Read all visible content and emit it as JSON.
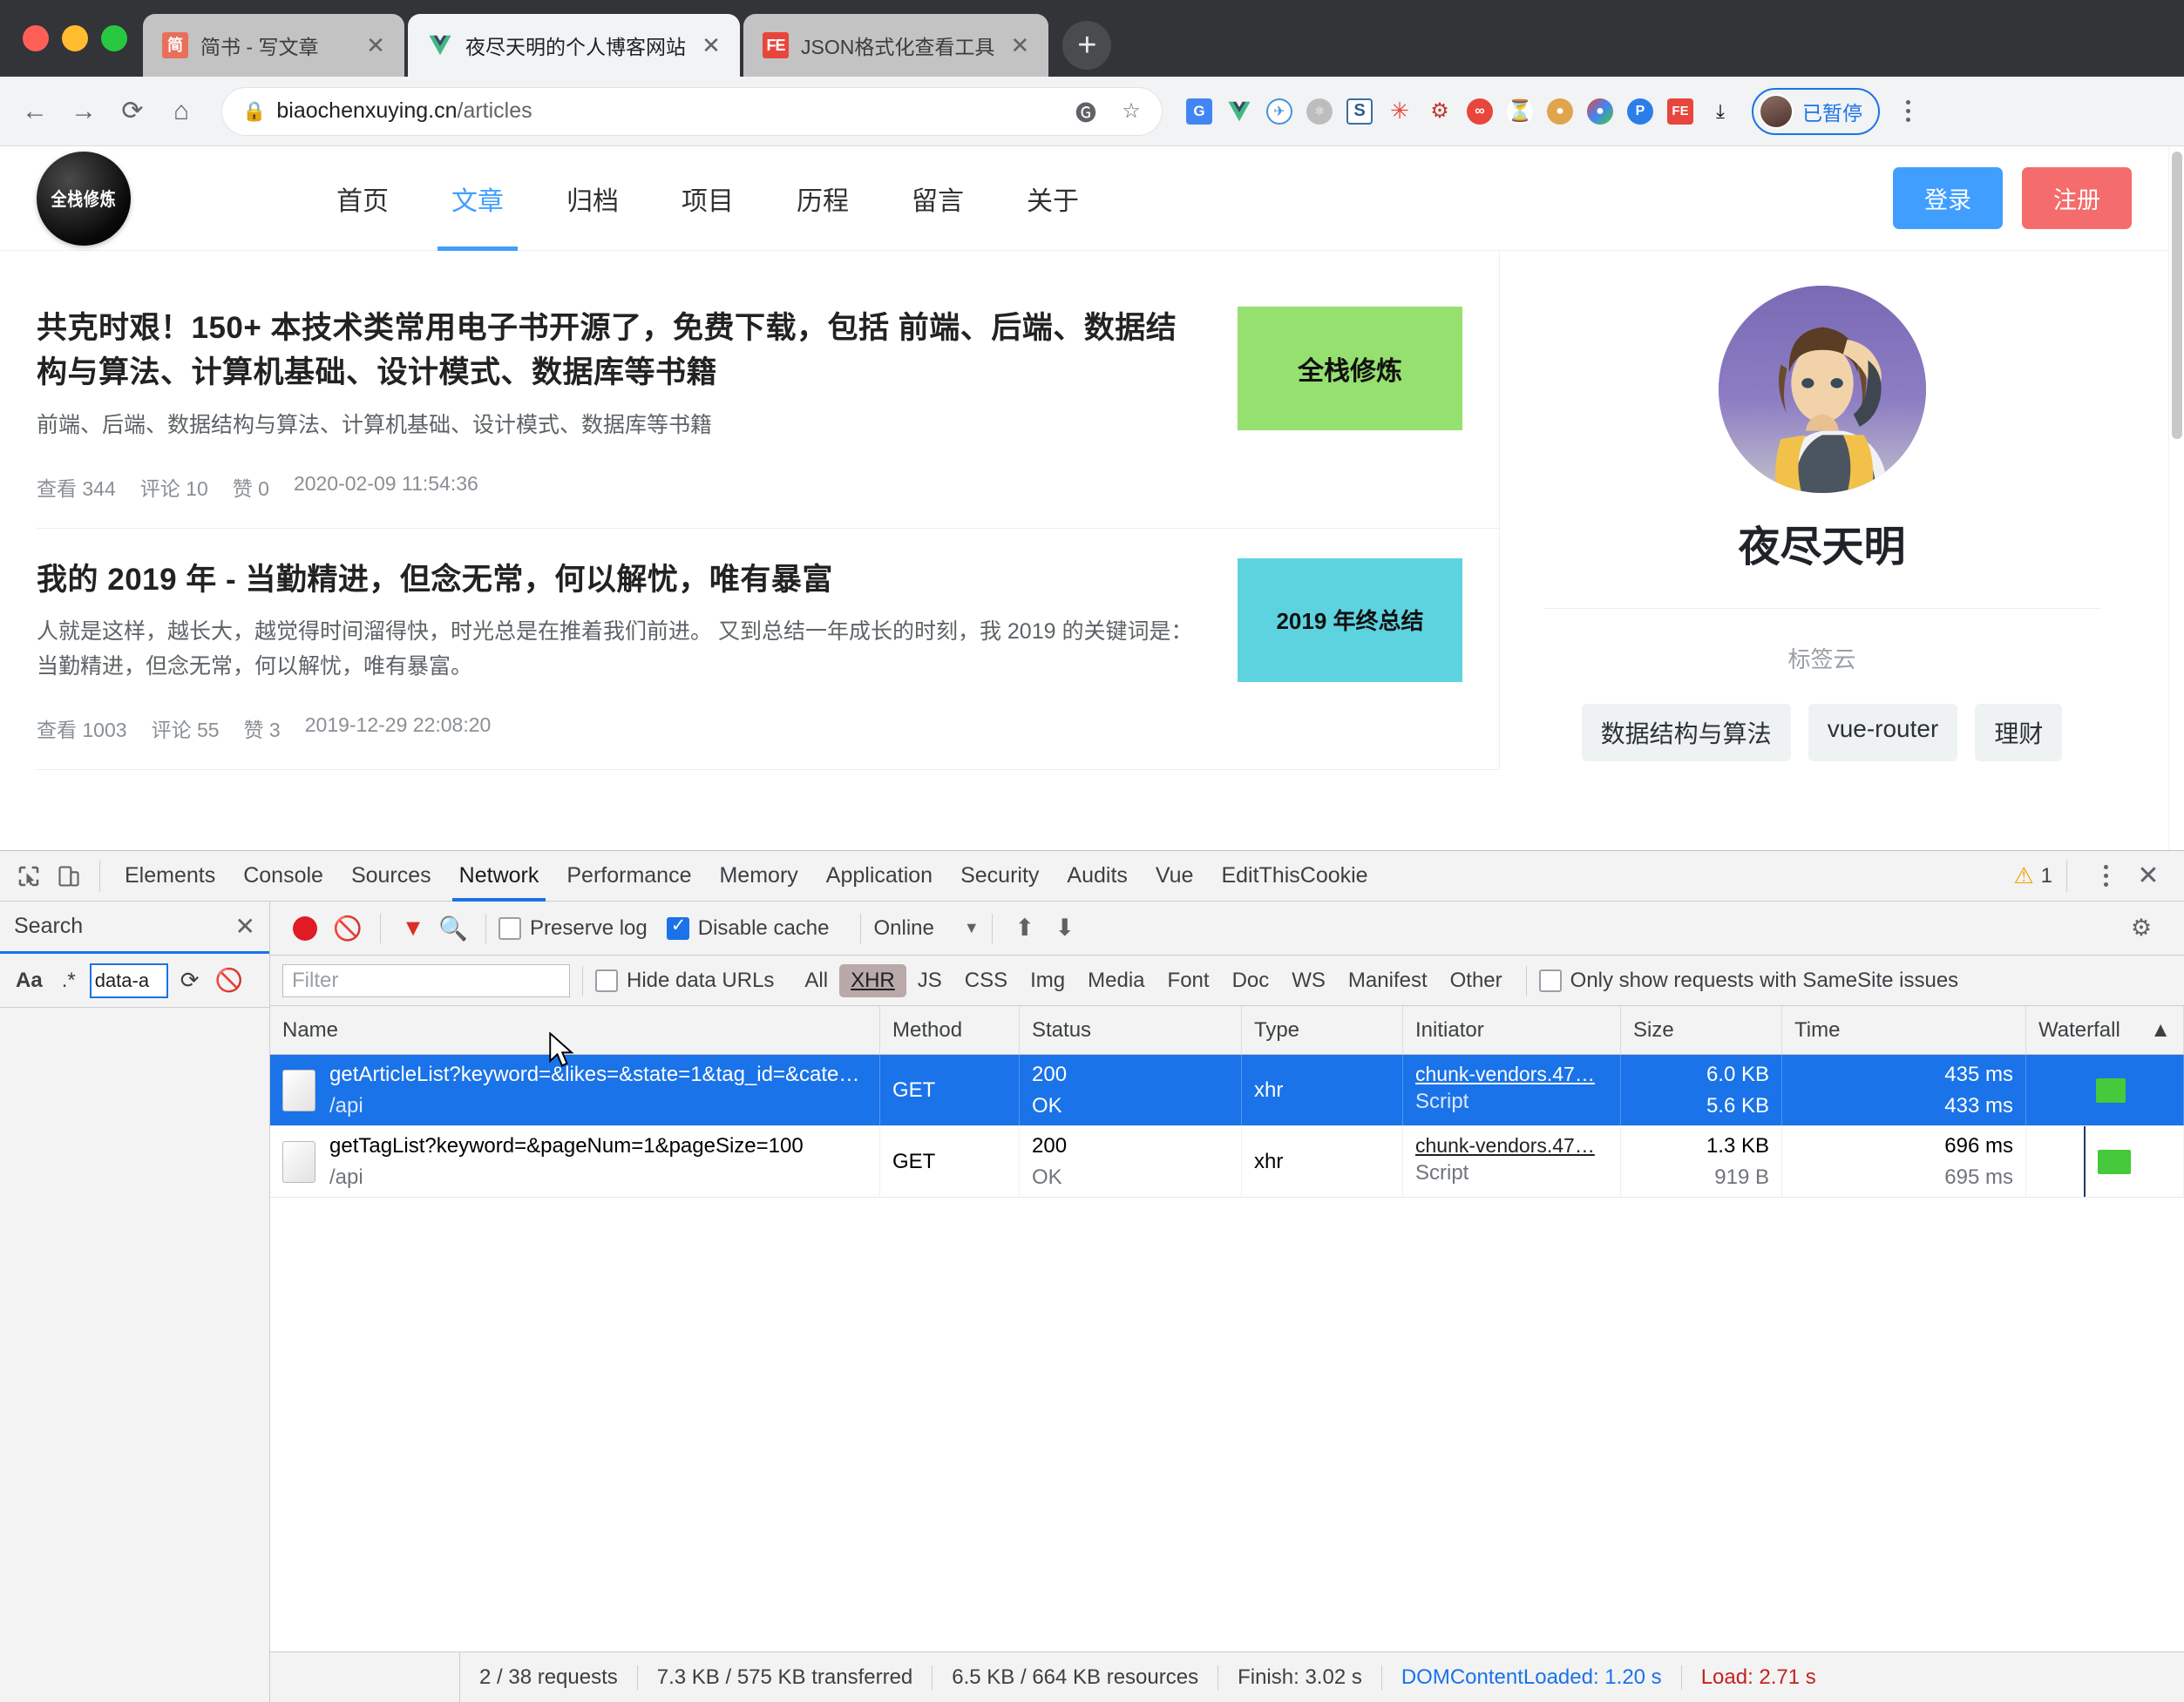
{
  "browser": {
    "tabs": [
      {
        "title": "简书 - 写文章",
        "favicon": "jianshu-icon",
        "active": false
      },
      {
        "title": "夜尽天明的个人博客网站",
        "favicon": "vue-icon",
        "active": true
      },
      {
        "title": "JSON格式化查看工具",
        "favicon": "json-tool-icon",
        "active": false
      }
    ],
    "new_tab_label": "+",
    "close_label": "✕",
    "nav": {
      "back": "←",
      "forward": "→",
      "reload": "⟳",
      "home": "⌂"
    },
    "omnibox": {
      "lock_icon": "lock-icon",
      "url_host": "biaochenxuying.cn",
      "url_path": "/articles",
      "translate_icon": "translate-icon",
      "bookmark_icon": "star-icon"
    },
    "extensions": [
      "google-translate-icon",
      "vue-devtools-icon",
      "wappalyzer-icon",
      "react-devtools-icon",
      "stylus-icon",
      "octotree-icon",
      "xpath-helper-icon",
      "infinity-newtab-icon",
      "tampermonkey-icon",
      "cookie-icon",
      "colorzilla-icon",
      "proxy-switchy-icon",
      "fehelper-icon",
      "download-icon"
    ],
    "profile": {
      "label": "已暂停",
      "avatar": "user-avatar"
    },
    "menu_icon": "kebab-menu-icon"
  },
  "site": {
    "logo_text": "全栈修炼",
    "nav": [
      {
        "label": "首页",
        "active": false
      },
      {
        "label": "文章",
        "active": true
      },
      {
        "label": "归档",
        "active": false
      },
      {
        "label": "项目",
        "active": false
      },
      {
        "label": "历程",
        "active": false
      },
      {
        "label": "留言",
        "active": false
      },
      {
        "label": "关于",
        "active": false
      }
    ],
    "login_label": "登录",
    "register_label": "注册",
    "articles": [
      {
        "title": "共克时艰！150+ 本技术类常用电子书开源了，免费下载，包括 前端、后端、数据结构与算法、计算机基础、设计模式、数据库等书籍",
        "desc": "前端、后端、数据结构与算法、计算机基础、设计模式、数据库等书籍",
        "views_label": "查看 344",
        "comments_label": "评论 10",
        "likes_label": "赞 0",
        "date": "2020-02-09 11:54:36",
        "thumb_text": "全栈修炼",
        "thumb_color": "#96e070"
      },
      {
        "title": "我的 2019 年 - 当勤精进，但念无常，何以解忧，唯有暴富",
        "desc": "人就是这样，越长大，越觉得时间溜得快，时光总是在推着我们前进。 又到总结一年成长的时刻，我 2019 的关键词是：当勤精进，但念无常，何以解忧，唯有暴富。",
        "views_label": "查看 1003",
        "comments_label": "评论 55",
        "likes_label": "赞 3",
        "date": "2019-12-29 22:08:20",
        "thumb_text": "2019 年终总结",
        "thumb_color": "#5ed3e0"
      }
    ],
    "sidebar": {
      "author_name": "夜尽天明",
      "tagcloud_title": "标签云",
      "tags": [
        "数据结构与算法",
        "vue-router",
        "理财"
      ]
    }
  },
  "devtools": {
    "inspect_icon": "inspect-element-icon",
    "device_icon": "device-toolbar-icon",
    "panels": [
      {
        "label": "Elements",
        "active": false
      },
      {
        "label": "Console",
        "active": false
      },
      {
        "label": "Sources",
        "active": false
      },
      {
        "label": "Network",
        "active": true
      },
      {
        "label": "Performance",
        "active": false
      },
      {
        "label": "Memory",
        "active": false
      },
      {
        "label": "Application",
        "active": false
      },
      {
        "label": "Security",
        "active": false
      },
      {
        "label": "Audits",
        "active": false
      },
      {
        "label": "Vue",
        "active": false
      },
      {
        "label": "EditThisCookie",
        "active": false
      }
    ],
    "warning_count": "1",
    "more_icon": "kebab-menu-icon",
    "close_icon": "close-icon",
    "search_panel": {
      "title": "Search",
      "close_label": "✕",
      "match_case_label": "Aa",
      "regex_label": ".*",
      "query_value": "data-a",
      "refresh_icon": "refresh-icon",
      "clear_icon": "clear-icon"
    },
    "network_toolbar": {
      "record_icon": "record-button",
      "clear_icon": "clear-icon",
      "filter_icon": "filter-icon",
      "search_icon": "search-icon",
      "preserve_log_label": "Preserve log",
      "preserve_log_checked": false,
      "disable_cache_label": "Disable cache",
      "disable_cache_checked": true,
      "throttle_value": "Online",
      "import_icon": "upload-har-icon",
      "export_icon": "download-har-icon",
      "settings_icon": "gear-icon"
    },
    "filter_bar": {
      "filter_placeholder": "Filter",
      "hide_data_urls_label": "Hide data URLs",
      "hide_data_urls_checked": false,
      "types": [
        {
          "label": "All",
          "active": false
        },
        {
          "label": "XHR",
          "active": true
        },
        {
          "label": "JS",
          "active": false
        },
        {
          "label": "CSS",
          "active": false
        },
        {
          "label": "Img",
          "active": false
        },
        {
          "label": "Media",
          "active": false
        },
        {
          "label": "Font",
          "active": false
        },
        {
          "label": "Doc",
          "active": false
        },
        {
          "label": "WS",
          "active": false
        },
        {
          "label": "Manifest",
          "active": false
        },
        {
          "label": "Other",
          "active": false
        }
      ],
      "samesite_label": "Only show requests with SameSite issues",
      "samesite_checked": false
    },
    "table": {
      "columns": [
        "Name",
        "Method",
        "Status",
        "Type",
        "Initiator",
        "Size",
        "Time",
        "Waterfall"
      ],
      "sort_icon": "sort-ascending-icon",
      "rows": [
        {
          "name": "getArticleList?keyword=&likes=&state=1&tag_id=&cate…",
          "path": "/api",
          "method": "GET",
          "status": "200",
          "status_text": "OK",
          "type": "xhr",
          "initiator": "chunk-vendors.47…",
          "initiator_type": "Script",
          "size": "6.0 KB",
          "size_transfer": "5.6 KB",
          "time": "435 ms",
          "time_latency": "433 ms",
          "selected": true
        },
        {
          "name": "getTagList?keyword=&pageNum=1&pageSize=100",
          "path": "/api",
          "method": "GET",
          "status": "200",
          "status_text": "OK",
          "type": "xhr",
          "initiator": "chunk-vendors.47…",
          "initiator_type": "Script",
          "size": "1.3 KB",
          "size_transfer": "919 B",
          "time": "696 ms",
          "time_latency": "695 ms",
          "selected": false
        }
      ]
    },
    "status_bar": {
      "requests": "2 / 38 requests",
      "transferred": "7.3 KB / 575 KB transferred",
      "resources": "6.5 KB / 664 KB resources",
      "finish": "Finish: 3.02 s",
      "dcl": "DOMContentLoaded: 1.20 s",
      "load": "Load: 2.71 s"
    }
  }
}
